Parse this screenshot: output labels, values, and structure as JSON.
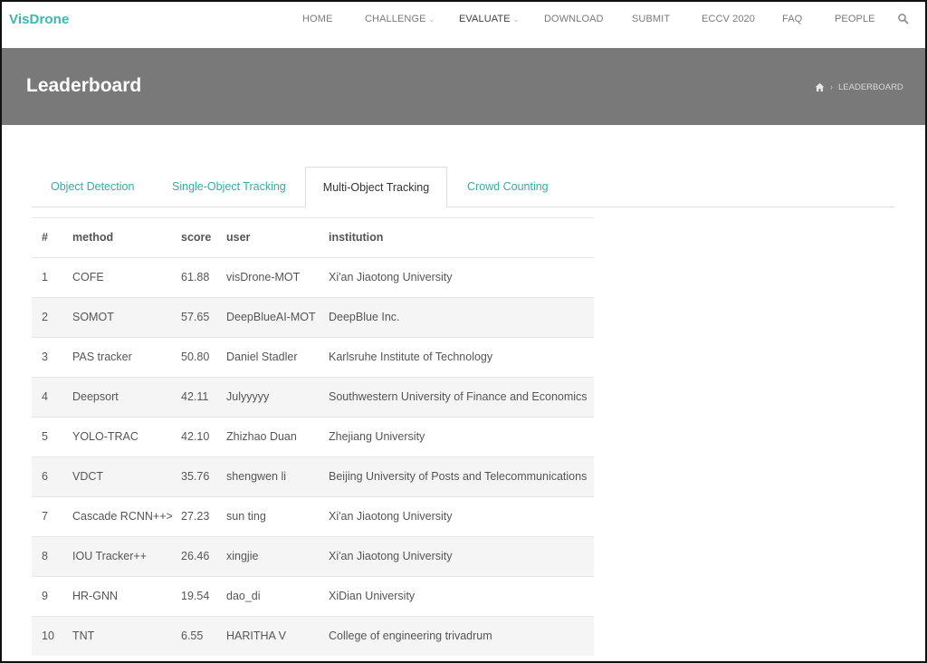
{
  "brand": {
    "logo": "VisDrone",
    "accent": "#3ab8b0"
  },
  "nav": {
    "items": [
      {
        "label": "HOME"
      },
      {
        "label": "CHALLENGE"
      },
      {
        "label": "EVALUATE"
      },
      {
        "label": "DOWNLOAD"
      },
      {
        "label": "SUBMIT"
      },
      {
        "label": "ECCV 2020"
      },
      {
        "label": "FAQ"
      },
      {
        "label": "PEOPLE"
      }
    ],
    "dropdown_chevron": "⌄",
    "search_icon": "search-icon"
  },
  "banner": {
    "title": "Leaderboard",
    "breadcrumb": {
      "home_icon": "home-icon",
      "separator": "›",
      "current": "LEADERBOARD"
    },
    "background": "#797979"
  },
  "tabs": [
    {
      "label": "Object Detection"
    },
    {
      "label": "Single-Object Tracking"
    },
    {
      "label": "Multi-Object Tracking",
      "selected": true
    },
    {
      "label": "Crowd Counting"
    }
  ],
  "table": {
    "columns": {
      "rank": "#",
      "method": "method",
      "score": "score",
      "user": "user",
      "institution": "institution"
    },
    "rows": [
      {
        "rank": "1",
        "method": "COFE",
        "score": "61.88",
        "user": "visDrone-MOT",
        "institution": "Xi'an Jiaotong University"
      },
      {
        "rank": "2",
        "method": "SOMOT",
        "score": "57.65",
        "user": "DeepBlueAI-MOT",
        "institution": "DeepBlue Inc."
      },
      {
        "rank": "3",
        "method": "PAS tracker",
        "score": "50.80",
        "user": "Daniel Stadler",
        "institution": "Karlsruhe Institute of Technology"
      },
      {
        "rank": "4",
        "method": "Deepsort",
        "score": "42.11",
        "user": "Julyyyyy",
        "institution": "Southwestern University of Finance and Economics"
      },
      {
        "rank": "5",
        "method": "YOLO-TRAC",
        "score": "42.10",
        "user": "Zhizhao Duan",
        "institution": "Zhejiang University"
      },
      {
        "rank": "6",
        "method": "VDCT",
        "score": "35.76",
        "user": "shengwen li",
        "institution": "Beijing University of Posts and Telecommunications"
      },
      {
        "rank": "7",
        "method": "Cascade RCNN++>",
        "score": "27.23",
        "user": "sun ting",
        "institution": "Xi'an Jiaotong University"
      },
      {
        "rank": "8",
        "method": "IOU Tracker++",
        "score": "26.46",
        "user": "xingjie",
        "institution": "Xi'an Jiaotong University"
      },
      {
        "rank": "9",
        "method": "HR-GNN",
        "score": "19.54",
        "user": "dao_di",
        "institution": "XiDian University"
      },
      {
        "rank": "10",
        "method": "TNT",
        "score": "6.55",
        "user": "HARITHA V",
        "institution": "College of engineering trivadrum"
      }
    ]
  }
}
